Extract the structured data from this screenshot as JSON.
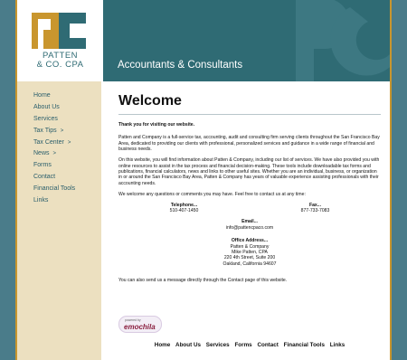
{
  "header": {
    "logo": {
      "name_line1": "PATTEN",
      "name_line2": "& CO. CPA",
      "monogram": "P&C monogram"
    },
    "tagline": "Accountants & Consultants",
    "colors": {
      "teal": "#2f6b74",
      "gold": "#c9962e",
      "background": "#4a7c8a",
      "sidebar": "#ece0c0"
    }
  },
  "sidebar": {
    "items": [
      {
        "label": "Home",
        "arrow": ""
      },
      {
        "label": "About Us",
        "arrow": ""
      },
      {
        "label": "Services",
        "arrow": ""
      },
      {
        "label": "Tax Tips",
        "arrow": ">"
      },
      {
        "label": "Tax Center",
        "arrow": ">"
      },
      {
        "label": "News",
        "arrow": ">"
      },
      {
        "label": "Forms",
        "arrow": ""
      },
      {
        "label": "Contact",
        "arrow": ""
      },
      {
        "label": "Financial Tools",
        "arrow": ""
      },
      {
        "label": "Links",
        "arrow": ""
      }
    ]
  },
  "main": {
    "title": "Welcome",
    "thanks": "Thank you for visiting our website.",
    "para1": "Patten and Company is a full-service tax, accounting, audit and consulting firm serving clients throughout the San Francisco Bay Area, dedicated to providing our clients with professional, personalized services and guidance in a wide range of financial and business needs.",
    "para2": "On this website, you will find information about Patten & Company, including our list of services. We have also provided you with online resources to assist in the tax process and financial decision-making. These tools include downloadable tax forms and publications, financial calculators, news and links to other useful sites. Whether you are an individual, business, or organization in or around the San Francisco Bay Area, Patten & Company has years of valuable experience assisting professionals with their accounting needs.",
    "para3": "We welcome any questions or comments you may have. Feel free to contact us at any time:",
    "telephone_label": "Telephone...",
    "telephone": "510-407-1450",
    "fax_label": "Fax...",
    "fax": "877-733-7083",
    "email_label": "Email...",
    "email": "info@pattencpaco.com",
    "office_label": "Office Address...",
    "office_line1": "Patten & Company",
    "office_line2": "Mike Patten, CPA",
    "office_line3": "220 4th Street, Suite 200",
    "office_line4": "Oakland, California 94607",
    "closing": "You can also send us a message directly through the Contact page of this website."
  },
  "badge": {
    "powered": "powered by",
    "brand": "emochila"
  },
  "footer": {
    "links": [
      "Home",
      "About Us",
      "Services",
      "Forms",
      "Contact",
      "Financial Tools",
      "Links"
    ]
  }
}
